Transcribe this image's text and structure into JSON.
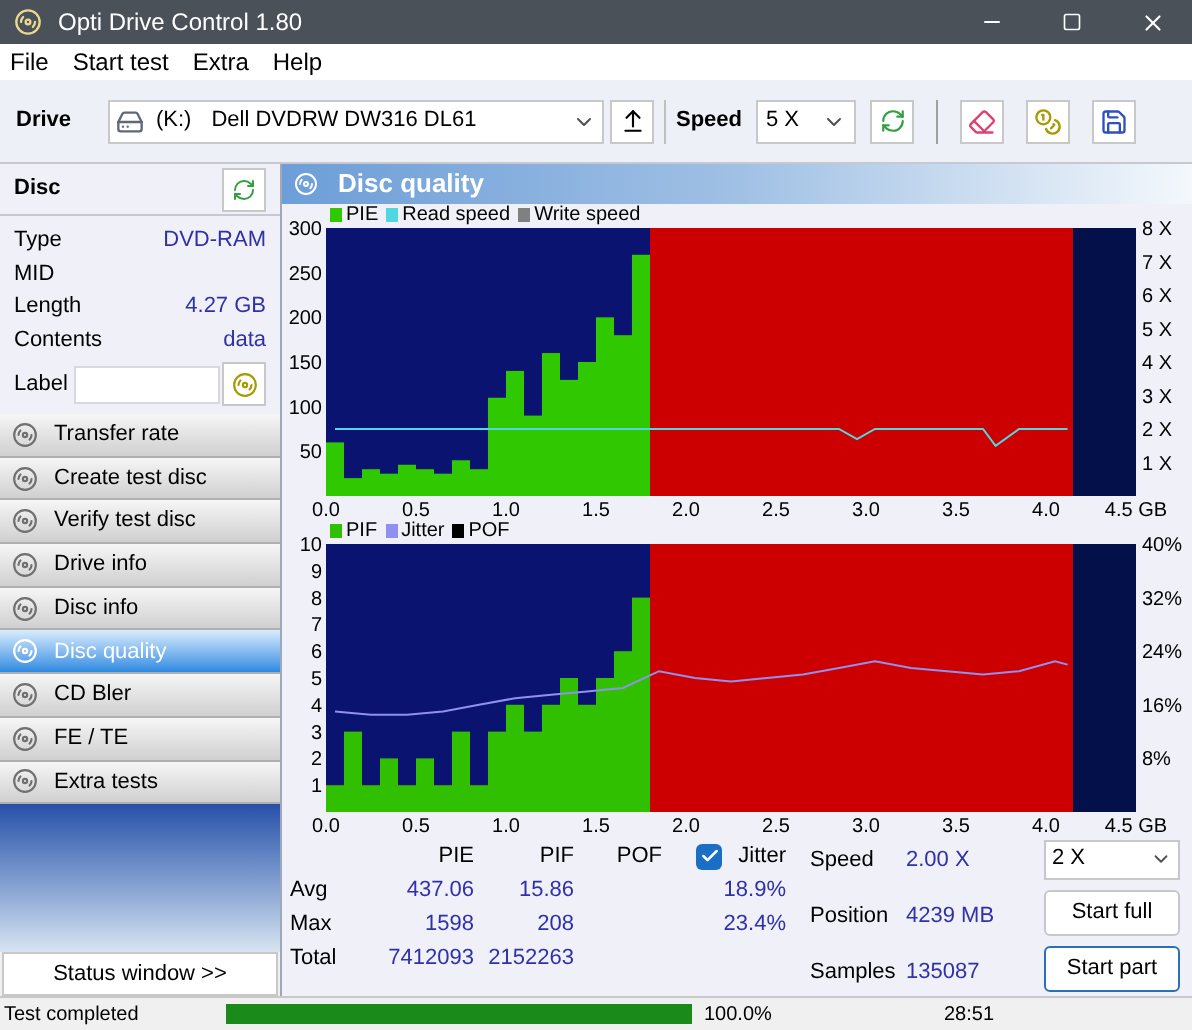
{
  "window": {
    "title": "Opti Drive Control 1.80"
  },
  "menu": [
    "File",
    "Start test",
    "Extra",
    "Help"
  ],
  "toolbar": {
    "drive_label": "Drive",
    "drive_letter": "(K:)",
    "drive_name": "Dell DVDRW DW316 DL61",
    "speed_label": "Speed",
    "speed": "5 X"
  },
  "disc": {
    "title": "Disc",
    "fields": [
      {
        "label": "Type",
        "value": "DVD-RAM"
      },
      {
        "label": "MID"
      },
      {
        "label": "Length",
        "value": "4.27 GB"
      },
      {
        "label": "Contents",
        "value": "data"
      }
    ],
    "label_field": "Label"
  },
  "nav": [
    {
      "label": "Transfer rate",
      "selected": false
    },
    {
      "label": "Create test disc",
      "selected": false
    },
    {
      "label": "Verify test disc",
      "selected": false
    },
    {
      "label": "Drive info",
      "selected": false
    },
    {
      "label": "Disc info",
      "selected": false
    },
    {
      "label": "Disc quality",
      "selected": true
    },
    {
      "label": "CD Bler",
      "selected": false
    },
    {
      "label": "FE / TE",
      "selected": false
    },
    {
      "label": "Extra tests",
      "selected": false
    }
  ],
  "status_window_button": "Status window >>",
  "panel_title": "Disc quality",
  "charts": [
    {
      "errors": {
        "chart_data": {
          "type": "bar",
          "xlim": [
            0,
            4.5
          ],
          "ylim": [
            0,
            300
          ],
          "x": [
            0.05,
            0.15,
            0.25,
            0.35,
            0.45,
            0.55,
            0.65,
            0.75,
            0.85,
            0.95,
            1.05,
            1.15,
            1.25,
            1.35,
            1.45,
            1.55,
            1.65,
            1.75
          ],
          "xticks": [
            {
              "value": 0,
              "label": "0.0"
            },
            {
              "value": 0.5,
              "label": "0.5"
            },
            {
              "value": 1,
              "label": "1.0"
            },
            {
              "value": 1.5,
              "label": "1.5"
            },
            {
              "value": 2,
              "label": "2.0"
            },
            {
              "value": 2.5,
              "label": "2.5"
            },
            {
              "value": 3,
              "label": "3.0"
            },
            {
              "value": 3.5,
              "label": "3.5"
            },
            {
              "value": 4,
              "label": "4.0"
            },
            {
              "value": 4.5,
              "label": "4.5 GB"
            }
          ],
          "yticks": [
            50,
            100,
            150,
            200,
            250,
            300
          ],
          "series": [
            {
              "name": "PIE",
              "color": "#30c800",
              "values": [
                60,
                20,
                30,
                25,
                35,
                30,
                25,
                40,
                30,
                110,
                140,
                90,
                160,
                130,
                150,
                200,
                180,
                270
              ]
            }
          ]
        }
      },
      "speed": {
        "chart_data": {
          "type": "line",
          "xlim": [
            0,
            4.5
          ],
          "ylim": [
            0,
            8
          ],
          "x": [
            0.05,
            0.25,
            0.45,
            0.65,
            0.85,
            1.05,
            1.25,
            1.45,
            1.65,
            1.85,
            2.05,
            2.25,
            2.45,
            2.65,
            2.85,
            2.95,
            3.05,
            3.25,
            3.45,
            3.65,
            3.72,
            3.85,
            4.05,
            4.12
          ],
          "yticks": [
            {
              "value": 1,
              "label": "1 X"
            },
            {
              "value": 2,
              "label": "2 X"
            },
            {
              "value": 3,
              "label": "3 X"
            },
            {
              "value": 4,
              "label": "4 X"
            },
            {
              "value": 5,
              "label": "5 X"
            },
            {
              "value": 6,
              "label": "6 X"
            },
            {
              "value": 7,
              "label": "7 X"
            },
            {
              "value": 8,
              "label": "8 X"
            }
          ],
          "series": [
            {
              "name": "Read speed",
              "color": "#50d8e0",
              "values": [
                2,
                2,
                2,
                2,
                2,
                2,
                2,
                2,
                2,
                2,
                2,
                2,
                2,
                2,
                2,
                1.7,
                2,
                2,
                2,
                2,
                1.5,
                2,
                2,
                2
              ]
            },
            {
              "name": "Write speed",
              "color": "#808080",
              "values": [
                null,
                null,
                null,
                null,
                null,
                null,
                null,
                null,
                null,
                null,
                null,
                null,
                null,
                null,
                null,
                null,
                null,
                null,
                null,
                null,
                null,
                null,
                null,
                null
              ]
            }
          ]
        }
      }
    },
    {
      "errors": {
        "chart_data": {
          "type": "bar",
          "xlim": [
            0,
            4.5
          ],
          "ylim": [
            0,
            10
          ],
          "x": [
            0.05,
            0.15,
            0.25,
            0.35,
            0.45,
            0.55,
            0.65,
            0.75,
            0.85,
            0.95,
            1.05,
            1.15,
            1.25,
            1.35,
            1.45,
            1.55,
            1.65,
            1.75
          ],
          "xticks": [
            {
              "value": 0,
              "label": "0.0"
            },
            {
              "value": 0.5,
              "label": "0.5"
            },
            {
              "value": 1,
              "label": "1.0"
            },
            {
              "value": 1.5,
              "label": "1.5"
            },
            {
              "value": 2,
              "label": "2.0"
            },
            {
              "value": 2.5,
              "label": "2.5"
            },
            {
              "value": 3,
              "label": "3.0"
            },
            {
              "value": 3.5,
              "label": "3.5"
            },
            {
              "value": 4,
              "label": "4.0"
            },
            {
              "value": 4.5,
              "label": "4.5 GB"
            }
          ],
          "yticks": [
            1,
            2,
            3,
            4,
            5,
            6,
            7,
            8,
            9,
            10
          ],
          "series": [
            {
              "name": "PIF",
              "color": "#30c000",
              "values": [
                1,
                3,
                1,
                2,
                1,
                2,
                1,
                3,
                1,
                3,
                4,
                3,
                4,
                5,
                4,
                5,
                6,
                8
              ]
            }
          ]
        }
      },
      "speed": {
        "chart_data": {
          "type": "line",
          "xlim": [
            0,
            4.5
          ],
          "ylim": [
            0,
            40
          ],
          "x": [
            0.05,
            0.25,
            0.45,
            0.65,
            0.85,
            1.05,
            1.25,
            1.45,
            1.65,
            1.85,
            2.05,
            2.25,
            2.45,
            2.65,
            2.85,
            3.05,
            3.25,
            3.45,
            3.65,
            3.85,
            4.05,
            4.12
          ],
          "yticks": [
            {
              "value": 8,
              "label": "8%"
            },
            {
              "value": 16,
              "label": "16%"
            },
            {
              "value": 24,
              "label": "24%"
            },
            {
              "value": 32,
              "label": "32%"
            },
            {
              "value": 40,
              "label": "40%"
            }
          ],
          "series": [
            {
              "name": "Jitter",
              "color": "#9090f0",
              "values": [
                15,
                14.5,
                14.5,
                15,
                16,
                17,
                17.5,
                18,
                18.5,
                21,
                20,
                19.5,
                20,
                20.5,
                21.5,
                22.5,
                21.5,
                21,
                20.5,
                21,
                22.5,
                22
              ]
            },
            {
              "name": "POF",
              "color": "#000000",
              "values": [
                null,
                null,
                null,
                null,
                null,
                null,
                null,
                null,
                null,
                null,
                null,
                null,
                null,
                null,
                null,
                null,
                null,
                null,
                null,
                null,
                null,
                null
              ]
            }
          ]
        }
      }
    }
  ],
  "stats": {
    "columns": [
      "PIE",
      "PIF",
      "POF"
    ],
    "jitter": {
      "label": "Jitter",
      "checked": true
    },
    "rows": [
      {
        "label": "Avg",
        "pie": "437.06",
        "pif": "15.86",
        "jitter": "18.9%"
      },
      {
        "label": "Max",
        "pie": "1598",
        "pif": "208",
        "jitter": "23.4%"
      },
      {
        "label": "Total",
        "pie": "7412093",
        "pif": "2152263"
      }
    ],
    "info": [
      {
        "label": "Speed",
        "value": "2.00 X"
      },
      {
        "label": "Position",
        "value": "4239 MB"
      },
      {
        "label": "Samples",
        "value": "135087"
      }
    ],
    "speed_select": "2 X",
    "buttons": [
      "Start full",
      "Start part"
    ]
  },
  "status_bar": {
    "text": "Test completed",
    "progress": {
      "level": 1
    },
    "percent": "100.0%",
    "time": "28:51"
  }
}
